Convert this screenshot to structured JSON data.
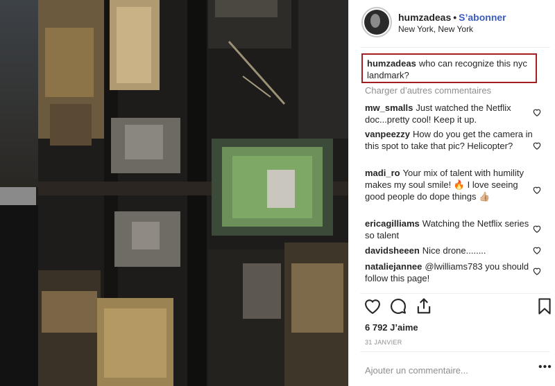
{
  "post": {
    "username": "humzadeas",
    "follow_dot": "•",
    "follow_label": "S’abonner",
    "location": "New York, New York",
    "caption_user": "humzadeas",
    "caption_text": "who can recognize this nyc landmark?",
    "load_more_label": "Charger d’autres commentaires",
    "likes": "6 792 J’aime",
    "date": "31 JANVIER",
    "add_comment_placeholder": "Ajouter un commentaire...",
    "more_label": "•••"
  },
  "comments": [
    {
      "user": "mw_smalls",
      "text": "Just watched the Netflix doc...pretty cool! Keep it up."
    },
    {
      "user": "vanpeezzy",
      "text": "How do you get the camera in this spot to take that pic? Helicopter?"
    },
    {
      "user": "madi_ro",
      "text": "Your mix of talent with humility makes my soul smile! 🔥 I love seeing good people do dope things 👍🏼"
    },
    {
      "user": "ericagilliams",
      "text": "Watching the Netflix series so talent"
    },
    {
      "user": "davidsheeen",
      "text": "Nice drone........"
    },
    {
      "user": "nataliejannee",
      "text": "@lwilliams783 you should follow this page!"
    }
  ],
  "icons": {
    "like": "heart-outline-icon",
    "comment": "speech-bubble-icon",
    "share": "share-arrow-icon",
    "save": "bookmark-icon",
    "comment_like": "heart-small-icon",
    "more": "ellipsis-icon"
  },
  "colors": {
    "follow": "#3b5bbf",
    "caption_border": "#a31f1f",
    "muted": "#8e8e8e"
  }
}
